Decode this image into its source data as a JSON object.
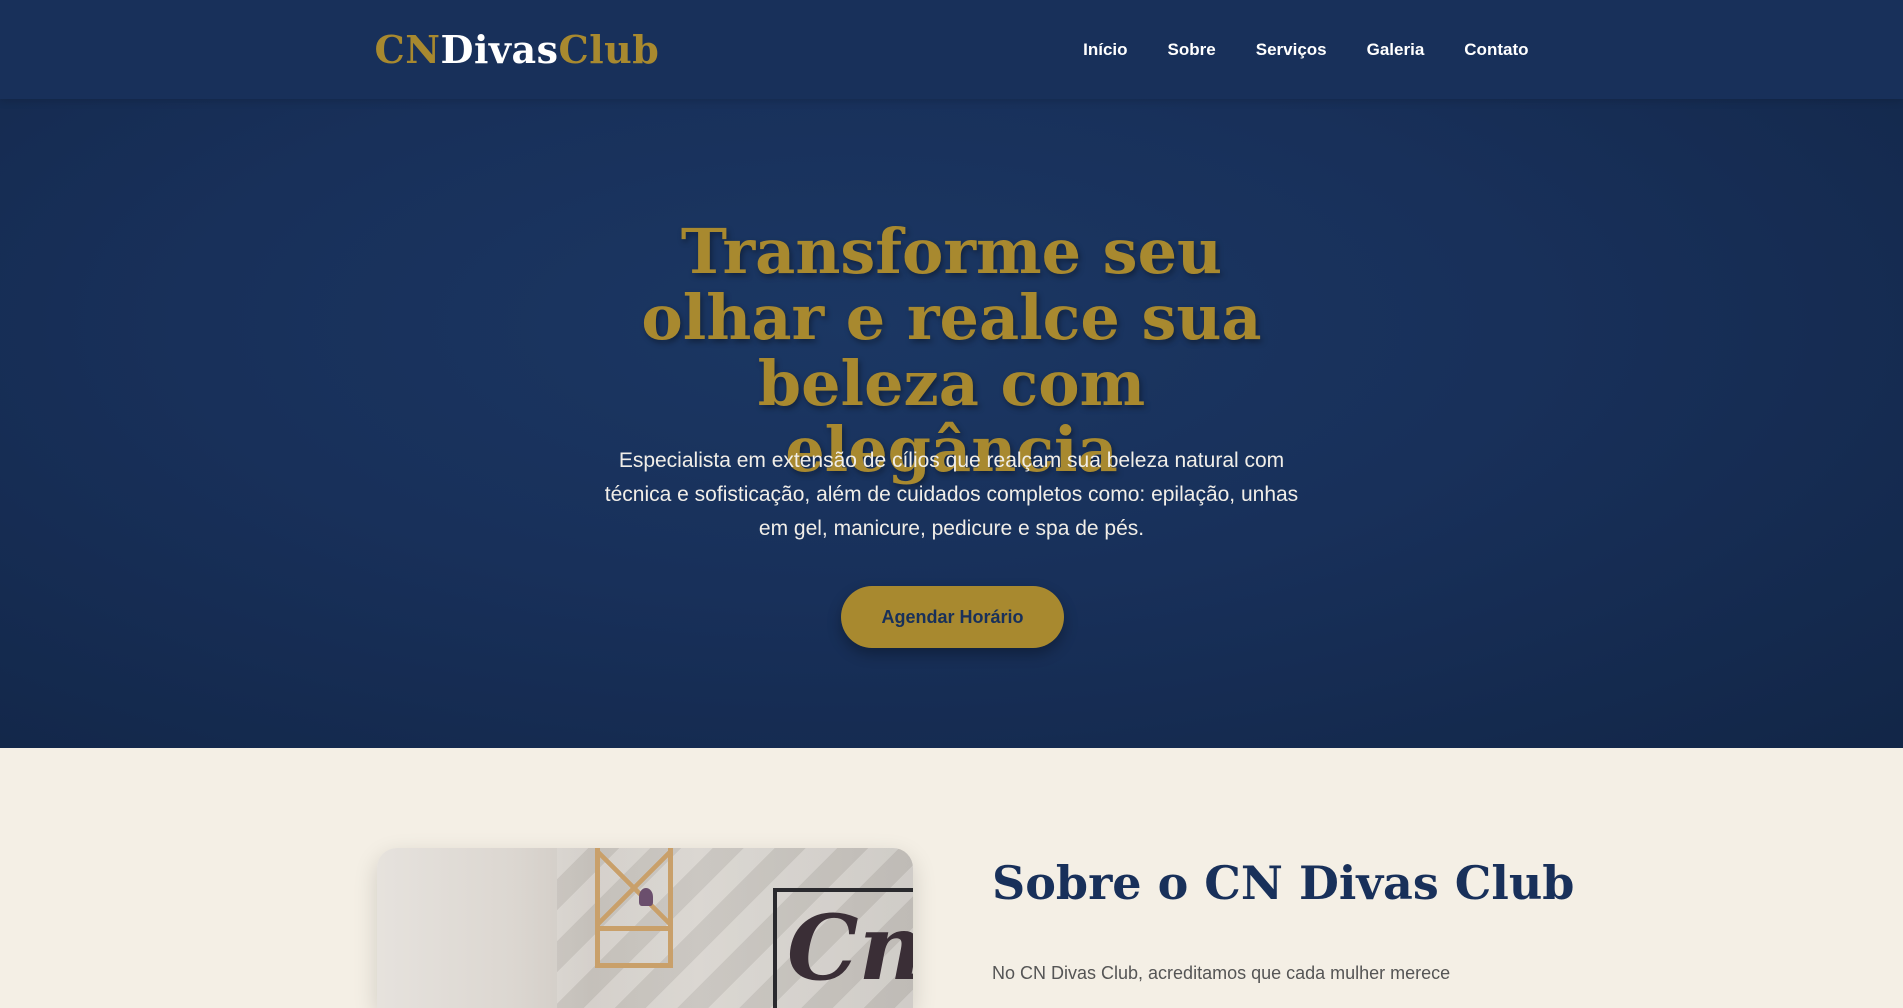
{
  "logo": {
    "part1": "CN",
    "part2": "Divas",
    "part3": "Club"
  },
  "nav": {
    "items": [
      {
        "label": "Início"
      },
      {
        "label": "Sobre"
      },
      {
        "label": "Serviços"
      },
      {
        "label": "Galeria"
      },
      {
        "label": "Contato"
      }
    ]
  },
  "hero": {
    "title": "Transforme seu olhar e realce sua beleza com elegância",
    "subtitle": "Especialista em extensão de cílios que realçam sua beleza natural com técnica e sofisticação, além de cuidados completos como: epilação, unhas em gel, manicure, pedicure e spa de pés.",
    "cta_label": "Agendar Horário"
  },
  "about": {
    "title": "Sobre o CN Divas Club",
    "text": "No CN Divas Club, acreditamos que cada mulher merece"
  },
  "colors": {
    "navy": "#18305a",
    "gold": "#a8892f",
    "cream": "#f4efe5"
  },
  "icons": {
    "about_image": "salon-interior-photo"
  }
}
